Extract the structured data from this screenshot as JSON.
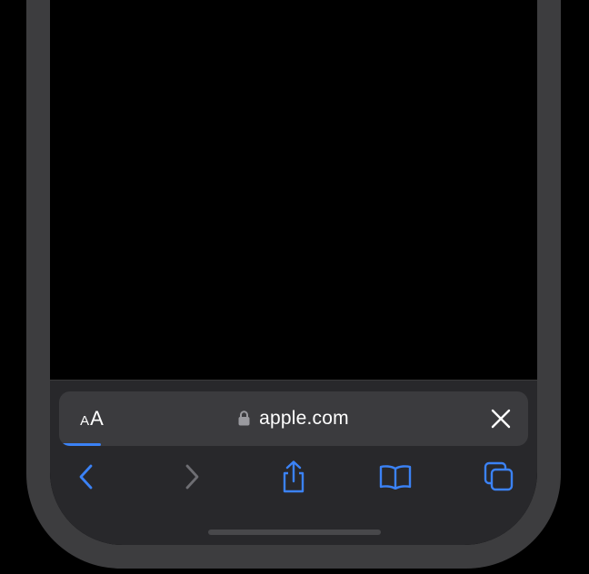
{
  "address_bar": {
    "text_size_small": "A",
    "text_size_large": "A",
    "url": "apple.com",
    "load_progress": 0.09
  },
  "icons": {
    "lock": "lock-icon",
    "stop": "close-icon",
    "back": "chevron-left-icon",
    "forward": "chevron-right-icon",
    "share": "share-icon",
    "bookmarks": "book-icon",
    "tabs": "tabs-icon"
  },
  "colors": {
    "accent": "#3b82f6",
    "disabled": "#6e6e73",
    "bar": "#3b3b3e",
    "toolbar": "#28282b",
    "frame": "#3d3d3f"
  },
  "nav": {
    "back_enabled": true,
    "forward_enabled": false
  }
}
